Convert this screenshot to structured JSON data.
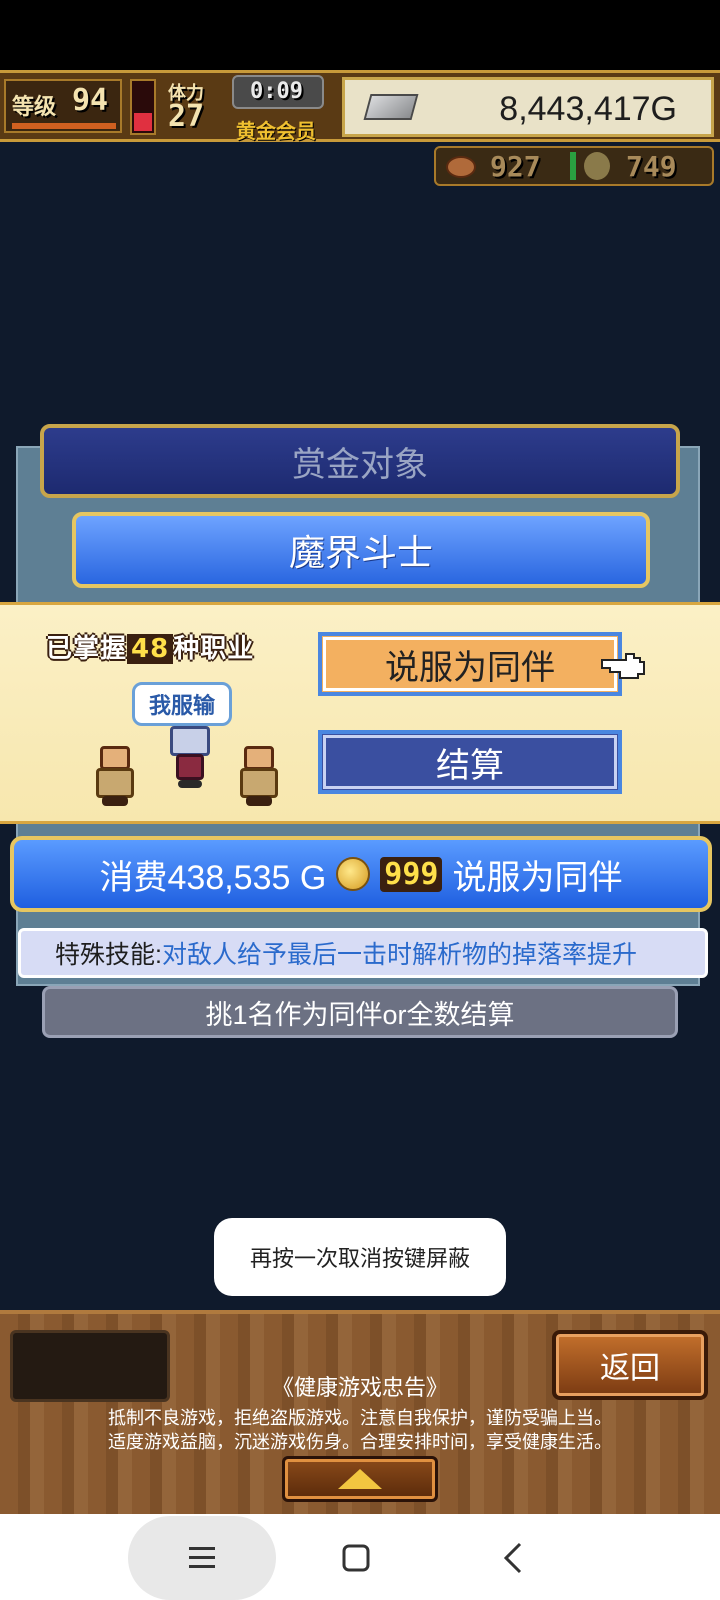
{
  "hud": {
    "level_label": "等级",
    "level_value": "94",
    "stamina_label": "体力",
    "stamina_value": "27",
    "timer": "0:09",
    "membership": "黄金会员",
    "gold": "8,443,417G",
    "resource_1": "927",
    "resource_2": "749"
  },
  "bounty": {
    "title": "赏金对象",
    "monster_name": "魔界斗士"
  },
  "choice": {
    "learned_prefix": "已掌握",
    "learned_count": "48",
    "learned_suffix": "种职业",
    "speech": "我服输",
    "persuade_label": "说服为同伴",
    "settle_label": "结算"
  },
  "cost": {
    "prefix": "消费438,535 G",
    "coin_count": "999",
    "suffix": "说服为同伴"
  },
  "skill": {
    "label": "特殊技能:",
    "description": "对敌人给予最后一击时解析物的掉落率提升"
  },
  "instruction": "挑1名作为同伴or全数结算",
  "toast": "再按一次取消按键屏蔽",
  "bottom": {
    "back_label": "返回",
    "health_title": "《健康游戏忠告》",
    "health_line1": "抵制不良游戏，拒绝盗版游戏。注意自我保护，谨防受骗上当。",
    "health_line2": "适度游戏益脑，沉迷游戏伤身。合理安排时间，享受健康生活。"
  },
  "icons": [
    "silver-bar-icon",
    "meat-icon",
    "coin-icon",
    "hand-pointer-icon",
    "up-arrow-icon",
    "menu-icon",
    "home-icon",
    "back-icon"
  ],
  "colors": {
    "accent_blue": "#2a66e0",
    "gold_frame": "#e6c661",
    "persuade_button": "#f3b060",
    "settle_button": "#3a4fa0"
  }
}
